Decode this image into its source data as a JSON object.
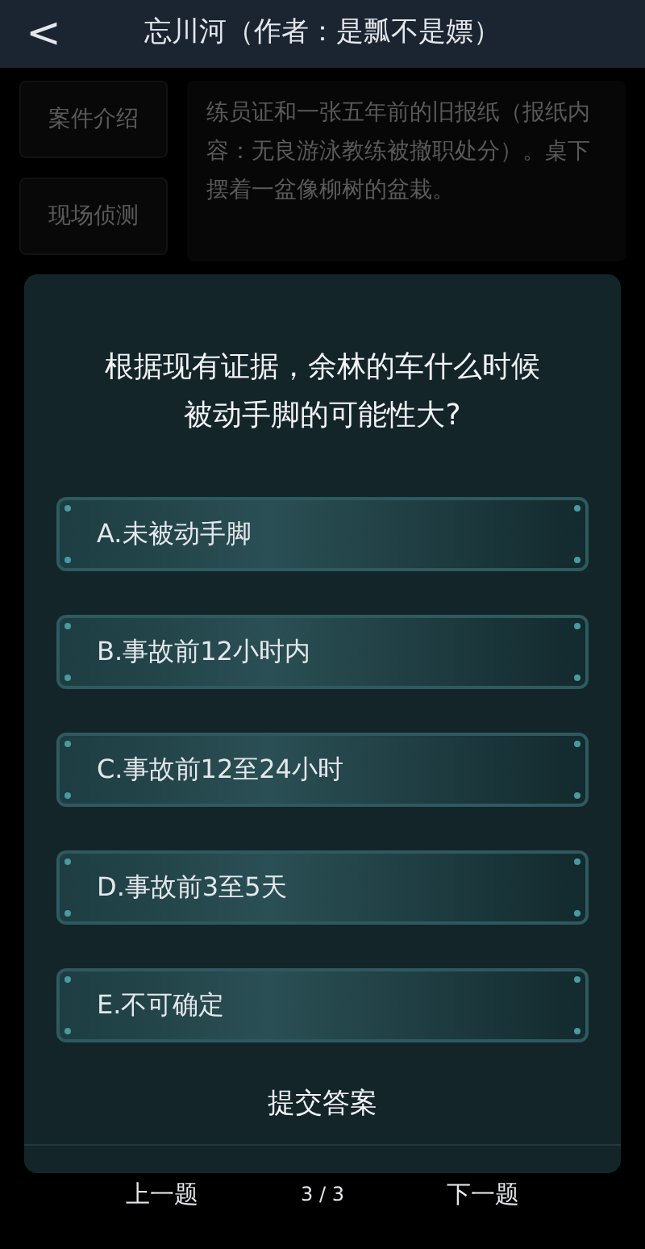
{
  "header": {
    "back": "<",
    "title": "忘川河（作者：是瓢不是嫖）"
  },
  "sidebar": {
    "items": [
      "案件介绍",
      "现场侦测"
    ]
  },
  "clue_text": "练员证和一张五年前的旧报纸（报纸内容：无良游泳教练被撤职处分）。桌下摆着一盆像柳树的盆栽。",
  "dialog": {
    "question": "根据现有证据，余林的车什么时候被动手脚的可能性大?",
    "options": [
      "A.未被动手脚",
      "B.事故前12小时内",
      "C.事故前12至24小时",
      "D.事故前3至5天",
      "E.不可确定"
    ],
    "submit": "提交答案"
  },
  "footer": {
    "prev": "上一题",
    "page": "3 / 3",
    "next": "下一题"
  }
}
